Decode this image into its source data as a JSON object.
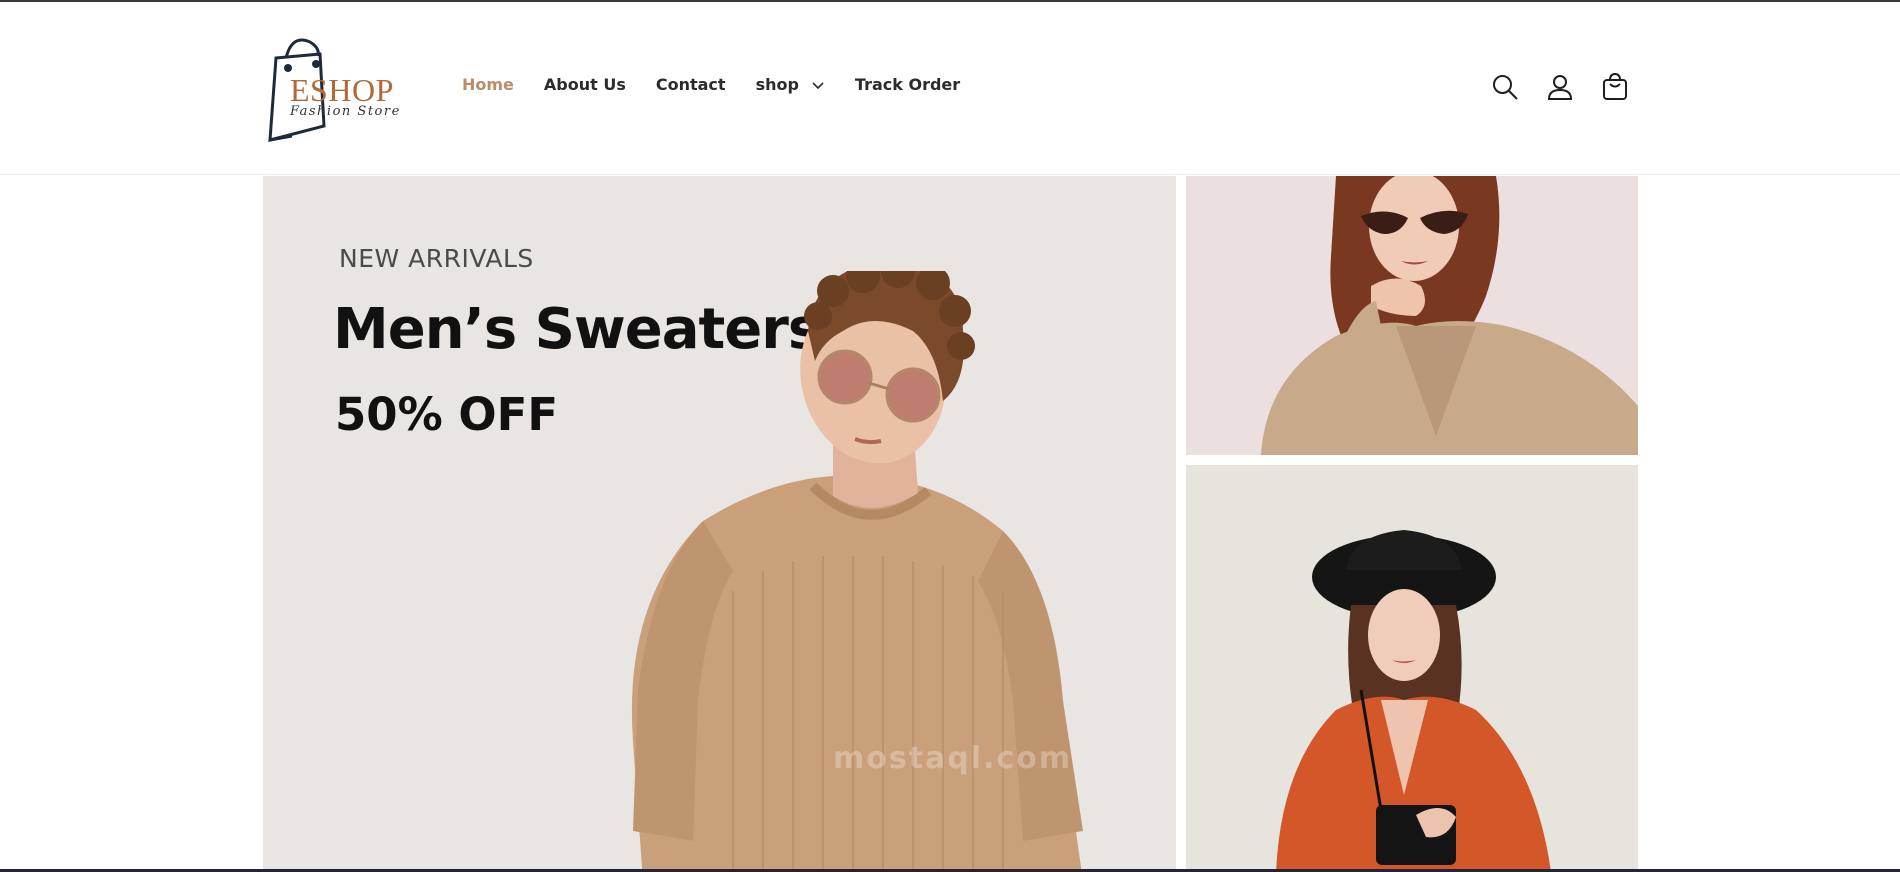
{
  "header": {
    "logo": {
      "name": "ESHOP",
      "tagline": "Fashion Store",
      "icon": "shopping-bag-logo"
    },
    "nav": [
      {
        "label": "Home",
        "active": true
      },
      {
        "label": "About Us",
        "active": false
      },
      {
        "label": "Contact",
        "active": false
      },
      {
        "label": "shop",
        "active": false,
        "has_dropdown": true
      },
      {
        "label": "Track Order",
        "active": false
      }
    ],
    "icons": [
      "search-icon",
      "account-icon",
      "cart-icon"
    ]
  },
  "hero": {
    "eyebrow": "NEW ARRIVALS",
    "title": "Men’s Sweaters",
    "discount": "50% OFF",
    "watermark": "mostaql.com"
  },
  "colors": {
    "accent": "#b88d6a",
    "logo_brown": "#b06a35",
    "hero_bg": "#e8e5e2",
    "side_top_bg": "#ebdfdf",
    "side_bottom_bg": "#e6e4dd",
    "sweater": "#c9a07a",
    "blazer": "#c8a98a",
    "orange_dress": "#d4572a"
  }
}
